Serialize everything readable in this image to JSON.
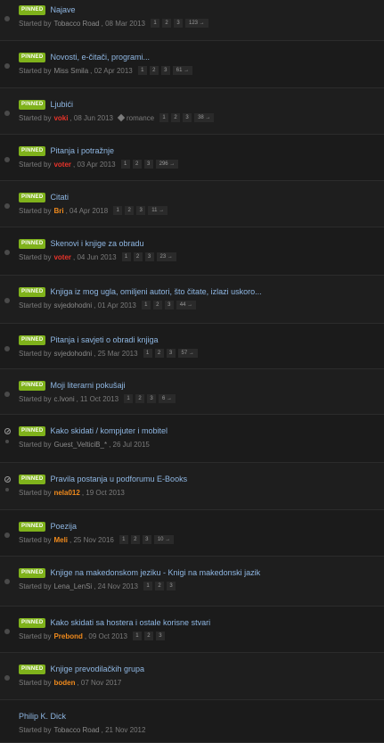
{
  "pinned_badge": "PINNED",
  "started_by": "Started by",
  "topics": [
    {
      "title": "Najave",
      "pinned": true,
      "status": "dot",
      "author": "Tobacco Road",
      "author_color": "plain",
      "date": ", 08 Mar 2013",
      "pages": [
        "1",
        "2",
        "3"
      ],
      "last_page": "123 →"
    },
    {
      "title": "Novosti, e-čitači, programi...",
      "pinned": true,
      "status": "dot",
      "author": "Miss Smila",
      "author_color": "plain",
      "date": ", 02 Apr 2013",
      "pages": [
        "1",
        "2",
        "3"
      ],
      "last_page": "61 →"
    },
    {
      "title": "Ljubići",
      "pinned": true,
      "status": "dot",
      "author": "voki",
      "author_color": "red",
      "date": ", 08 Jun 2013",
      "tag": "romance",
      "pages": [
        "1",
        "2",
        "3"
      ],
      "last_page": "38 →"
    },
    {
      "title": "Pitanja i potražnje",
      "pinned": true,
      "status": "dot",
      "author": "voter",
      "author_color": "red",
      "date": ", 03 Apr 2013",
      "pages": [
        "1",
        "2",
        "3"
      ],
      "last_page": "296 →"
    },
    {
      "title": "Citati",
      "pinned": true,
      "status": "dot",
      "author": "Bri",
      "author_color": "orange",
      "date": ", 04 Apr 2018",
      "pages": [
        "1",
        "2",
        "3"
      ],
      "last_page": "11 →"
    },
    {
      "title": "Skenovi i knjige za obradu",
      "pinned": true,
      "status": "dot",
      "author": "voter",
      "author_color": "red",
      "date": ", 04 Jun 2013",
      "pages": [
        "1",
        "2",
        "3"
      ],
      "last_page": "23 →"
    },
    {
      "title": "Knjiga iz mog ugla, omiljeni autori, što čitate, izlazi uskoro...",
      "pinned": true,
      "status": "dot",
      "author": "svjedohodni",
      "author_color": "plain",
      "date": ", 01 Apr 2013",
      "pages": [
        "1",
        "2",
        "3"
      ],
      "last_page": "44 →"
    },
    {
      "title": "Pitanja i savjeti o obradi knjiga",
      "pinned": true,
      "status": "dot",
      "author": "svjedohodni",
      "author_color": "plain",
      "date": ", 25 Mar 2013",
      "pages": [
        "1",
        "2",
        "3"
      ],
      "last_page": "57 →"
    },
    {
      "title": "Moji literarni pokušaji",
      "pinned": true,
      "status": "dot",
      "author": "c.Ivoni",
      "author_color": "plain",
      "date": ", 11 Oct 2013",
      "pages": [
        "1",
        "2",
        "3"
      ],
      "last_page": "6 →"
    },
    {
      "title": "Kako skidati / kompjuter i mobitel",
      "pinned": true,
      "status": "locked",
      "author": "Guest_VelticiB_*",
      "author_color": "plain",
      "date": ", 26 Jul 2015",
      "pages": [],
      "last_page": ""
    },
    {
      "title": "Pravila postanja u podforumu E-Books",
      "pinned": true,
      "status": "locked",
      "author": "nela012",
      "author_color": "orange",
      "date": ", 19 Oct 2013",
      "pages": [],
      "last_page": ""
    },
    {
      "title": "Poezija",
      "pinned": true,
      "status": "dot",
      "author": "Meli",
      "author_color": "orange",
      "date": ", 25 Nov 2016",
      "pages": [
        "1",
        "2",
        "3"
      ],
      "last_page": "10 →"
    },
    {
      "title": "Knjige na makedonskom jeziku - Knigi na makedonski jazik",
      "pinned": true,
      "status": "dot",
      "author": "Lena_LenSi",
      "author_color": "plain",
      "date": ", 24 Nov 2013",
      "pages": [
        "1",
        "2",
        "3"
      ],
      "last_page": ""
    },
    {
      "title": "Kako skidati sa hostera i ostale korisne stvari",
      "pinned": true,
      "status": "dot",
      "author": "Prebond",
      "author_color": "orange",
      "date": ", 09 Oct 2013",
      "pages": [
        "1",
        "2",
        "3"
      ],
      "last_page": ""
    },
    {
      "title": "Knjige prevodilačkih grupa",
      "pinned": true,
      "status": "dot",
      "author": "boden",
      "author_color": "orange",
      "date": ", 07 Nov 2017",
      "pages": [],
      "last_page": ""
    },
    {
      "title": "Philip K. Dick",
      "pinned": false,
      "status": "none",
      "author": "Tobacco Road",
      "author_color": "plain",
      "date": ", 21 Nov 2012",
      "pages": [],
      "last_page": ""
    }
  ]
}
